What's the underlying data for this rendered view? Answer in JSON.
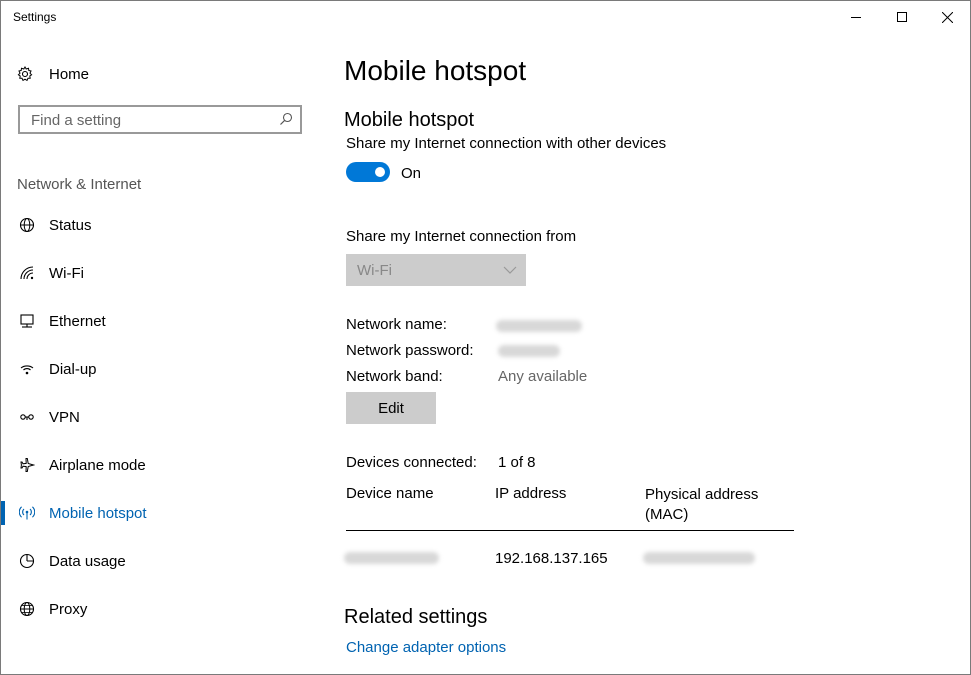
{
  "window": {
    "title": "Settings",
    "controls": {
      "minimize": "minimize-icon",
      "maximize": "maximize-icon",
      "close": "close-icon"
    }
  },
  "sidebar": {
    "home_label": "Home",
    "search_placeholder": "Find a setting",
    "section_label": "Network & Internet",
    "items": [
      {
        "label": "Status",
        "icon": "globe-status-icon"
      },
      {
        "label": "Wi-Fi",
        "icon": "wifi-icon"
      },
      {
        "label": "Ethernet",
        "icon": "ethernet-icon"
      },
      {
        "label": "Dial-up",
        "icon": "dialup-icon"
      },
      {
        "label": "VPN",
        "icon": "vpn-icon"
      },
      {
        "label": "Airplane mode",
        "icon": "airplane-icon"
      },
      {
        "label": "Mobile hotspot",
        "icon": "hotspot-icon",
        "active": true
      },
      {
        "label": "Data usage",
        "icon": "data-usage-icon"
      },
      {
        "label": "Proxy",
        "icon": "globe-icon"
      }
    ]
  },
  "main": {
    "page_title": "Mobile hotspot",
    "section_title": "Mobile hotspot",
    "share_description": "Share my Internet connection with other devices",
    "toggle_state": "On",
    "share_from_label": "Share my Internet connection from",
    "share_from_value": "Wi-Fi",
    "network_name_label": "Network name:",
    "network_password_label": "Network password:",
    "network_band_label": "Network band:",
    "network_band_value": "Any available",
    "edit_button": "Edit",
    "devices_connected_label": "Devices connected:",
    "devices_connected_value": "1 of 8",
    "table": {
      "headers": [
        "Device name",
        "IP address",
        "Physical address (MAC)"
      ],
      "rows": [
        {
          "ip": "192.168.137.165"
        }
      ]
    },
    "related_title": "Related settings",
    "related_link": "Change adapter options"
  },
  "colors": {
    "accent": "#0078d7",
    "link": "#0063b1",
    "button_bg": "#cccccc"
  }
}
